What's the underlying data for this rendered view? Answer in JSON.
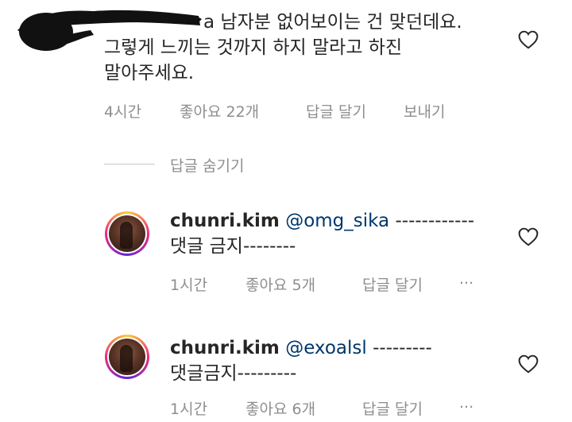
{
  "top_comment": {
    "line1": "a 남자분 없어보이는 건 맞던데요.",
    "line2": "그렇게 느끼는 것까지 하지 말라고 하진",
    "line3": "말아주세요.",
    "time": "4시간",
    "likes": "좋아요 22개",
    "reply": "답글 달기",
    "send": "보내기",
    "like_icon": "heart-outline-icon"
  },
  "hide_replies": "답글 숨기기",
  "replies": [
    {
      "username": "chunri.kim",
      "mention": "@omg_sika",
      "after_mention": " ------------",
      "line2": "댓글 금지--------",
      "time": "1시간",
      "likes": "좋아요 5개",
      "reply": "답글 달기",
      "more": "...",
      "like_icon": "heart-outline-icon"
    },
    {
      "username": "chunri.kim",
      "mention": "@exoalsl",
      "after_mention": " ---------",
      "line2": "댓글금지---------",
      "time": "1시간",
      "likes": "좋아요 6개",
      "reply": "답글 달기",
      "more": "...",
      "like_icon": "heart-outline-icon"
    }
  ],
  "colors": {
    "text": "#262626",
    "secondary": "#8e8e8e",
    "mention": "#00376b",
    "story_ring": [
      "#f9ce34",
      "#ee2a7b",
      "#6228d7"
    ]
  }
}
